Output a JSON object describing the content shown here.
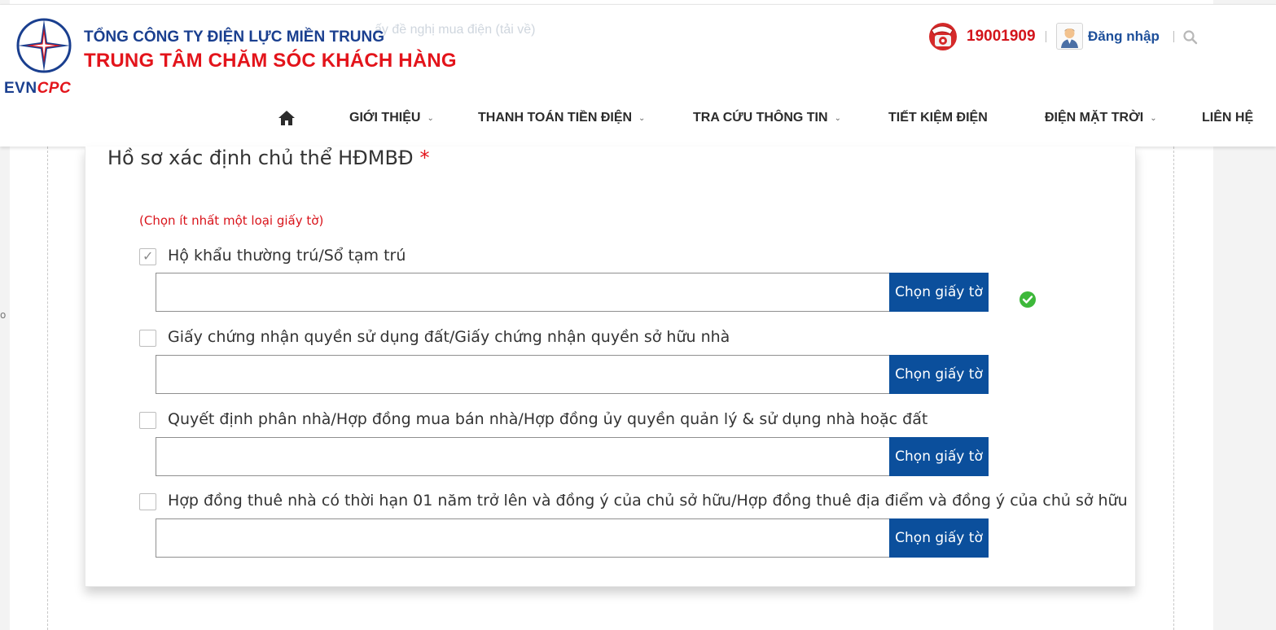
{
  "header": {
    "ghost_text": "ấy đề nghị mua điện (tải về)",
    "brand_evn": "EVN",
    "brand_cpc": "CPC",
    "company": "TỔNG CÔNG TY ĐIỆN LỰC MIỀN TRUNG",
    "center": "TRUNG TÂM CHĂM SÓC KHÁCH HÀNG",
    "hotline": "19001909",
    "login": "Đăng nhập"
  },
  "nav": {
    "items": [
      {
        "label": "GIỚI THIỆU",
        "has_dropdown": true
      },
      {
        "label": "THANH TOÁN TIỀN ĐIỆN",
        "has_dropdown": true
      },
      {
        "label": "TRA CỨU THÔNG TIN",
        "has_dropdown": true
      },
      {
        "label": "TIẾT KIỆM ĐIỆN",
        "has_dropdown": false
      },
      {
        "label": "ĐIỆN MẶT TRỜI",
        "has_dropdown": true
      },
      {
        "label": "LIÊN HỆ",
        "has_dropdown": false
      }
    ],
    "chevron": "⌄"
  },
  "form": {
    "title": "Hồ sơ xác định chủ thể HĐMBĐ",
    "required_mark": "*",
    "hint": "(Chọn ít nhất một loại giấy tờ)",
    "button_label": "Chọn giấy tờ",
    "documents": [
      {
        "label": "Hộ khẩu thường trú/Sổ tạm trú",
        "checked": true,
        "file_value": "",
        "valid": true
      },
      {
        "label": "Giấy chứng nhận quyền sử dụng đất/Giấy chứng nhận quyền sở hữu nhà",
        "checked": false,
        "file_value": ""
      },
      {
        "label": "Quyết định phân nhà/Hợp đồng mua bán nhà/Hợp đồng ủy quyền quản lý & sử dụng nhà hoặc đất",
        "checked": false,
        "file_value": ""
      },
      {
        "label": "Hợp đồng thuê nhà có thời hạn 01 năm trở lên và đồng ý của chủ sở hữu/Hợp đồng thuê địa điểm và đồng ý của chủ sở hữu",
        "checked": false,
        "file_value": ""
      }
    ]
  },
  "colors": {
    "brand_blue": "#1a3f8f",
    "brand_red": "#e3141b",
    "button_blue": "#0b4f9c",
    "success_green": "#3db83a"
  },
  "icons": {
    "home": "home-icon",
    "phone": "phone-icon",
    "search": "search-icon",
    "avatar": "user-avatar-icon",
    "valid": "check-circle-icon"
  }
}
